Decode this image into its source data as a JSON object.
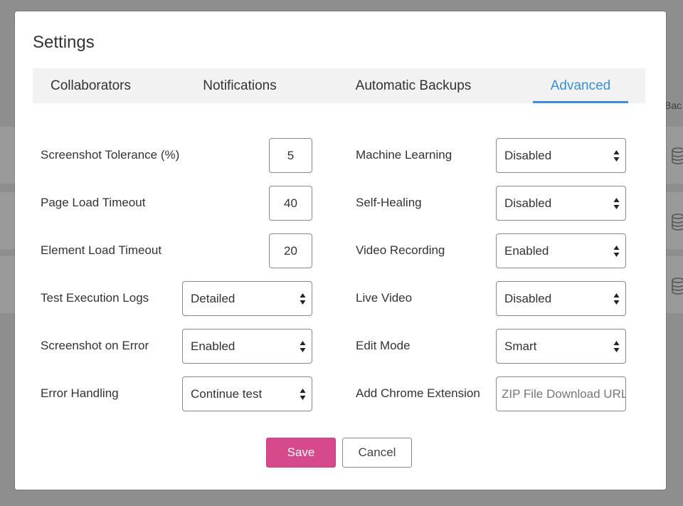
{
  "background": {
    "header_fragment": "Bac",
    "icon": "database-icon"
  },
  "modal": {
    "title": "Settings",
    "tabs": [
      {
        "label": "Collaborators",
        "active": false
      },
      {
        "label": "Notifications",
        "active": false
      },
      {
        "label": "Automatic Backups",
        "active": false
      },
      {
        "label": "Advanced",
        "active": true
      }
    ],
    "left_fields": [
      {
        "label": "Screenshot Tolerance (%)",
        "type": "number",
        "value": "5"
      },
      {
        "label": "Page Load Timeout",
        "type": "number",
        "value": "40"
      },
      {
        "label": "Element Load Timeout",
        "type": "number",
        "value": "20"
      },
      {
        "label": "Test Execution Logs",
        "type": "select",
        "value": "Detailed"
      },
      {
        "label": "Screenshot on Error",
        "type": "select",
        "value": "Enabled"
      },
      {
        "label": "Error Handling",
        "type": "select",
        "value": "Continue test"
      }
    ],
    "right_fields": [
      {
        "label": "Machine Learning",
        "type": "select",
        "value": "Disabled"
      },
      {
        "label": "Self-Healing",
        "type": "select",
        "value": "Disabled"
      },
      {
        "label": "Video Recording",
        "type": "select",
        "value": "Enabled"
      },
      {
        "label": "Live Video",
        "type": "select",
        "value": "Disabled"
      },
      {
        "label": "Edit Mode",
        "type": "select",
        "value": "Smart"
      },
      {
        "label": "Add Chrome Extension",
        "type": "text",
        "value": "",
        "placeholder": "ZIP File Download URL"
      }
    ],
    "buttons": {
      "save_label": "Save",
      "cancel_label": "Cancel"
    },
    "colors": {
      "accent": "#3a8fd8",
      "save": "#d6498a"
    }
  }
}
